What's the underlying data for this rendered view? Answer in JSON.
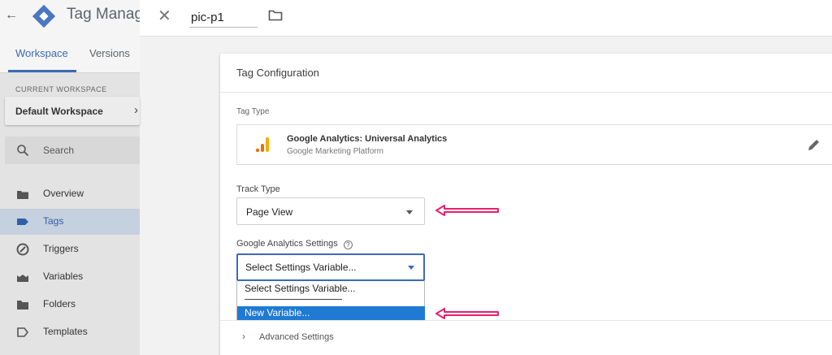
{
  "app": {
    "title": "Tag Manager"
  },
  "sidebar": {
    "tabs": [
      {
        "label": "Workspace"
      },
      {
        "label": "Versions"
      }
    ],
    "current_workspace_label": "CURRENT WORKSPACE",
    "workspace_name": "Default Workspace",
    "search_label": "Search",
    "items": [
      {
        "label": "Overview",
        "icon": "overview-icon"
      },
      {
        "label": "Tags",
        "icon": "tag-icon",
        "active": true
      },
      {
        "label": "Triggers",
        "icon": "trigger-icon"
      },
      {
        "label": "Variables",
        "icon": "variables-icon"
      },
      {
        "label": "Folders",
        "icon": "folder-icon"
      },
      {
        "label": "Templates",
        "icon": "template-icon"
      }
    ]
  },
  "topbar": {
    "tag_name": "pic-p1"
  },
  "card": {
    "title": "Tag Configuration",
    "tag_type_label": "Tag Type",
    "tag_type_name": "Google Analytics: Universal Analytics",
    "tag_type_sub": "Google Marketing Platform",
    "track_type_label": "Track Type",
    "track_type_value": "Page View",
    "ga_settings_label": "Google Analytics Settings",
    "ga_settings_value": "Select Settings Variable...",
    "dropdown_options": [
      "Select Settings Variable...",
      "New Variable..."
    ],
    "advanced_label": "Advanced Settings"
  },
  "colors": {
    "accent": "#3b6bb4",
    "highlight": "#1f7ad4",
    "annotation": "#e6216f",
    "analytics_orange": "#f9ab00"
  }
}
